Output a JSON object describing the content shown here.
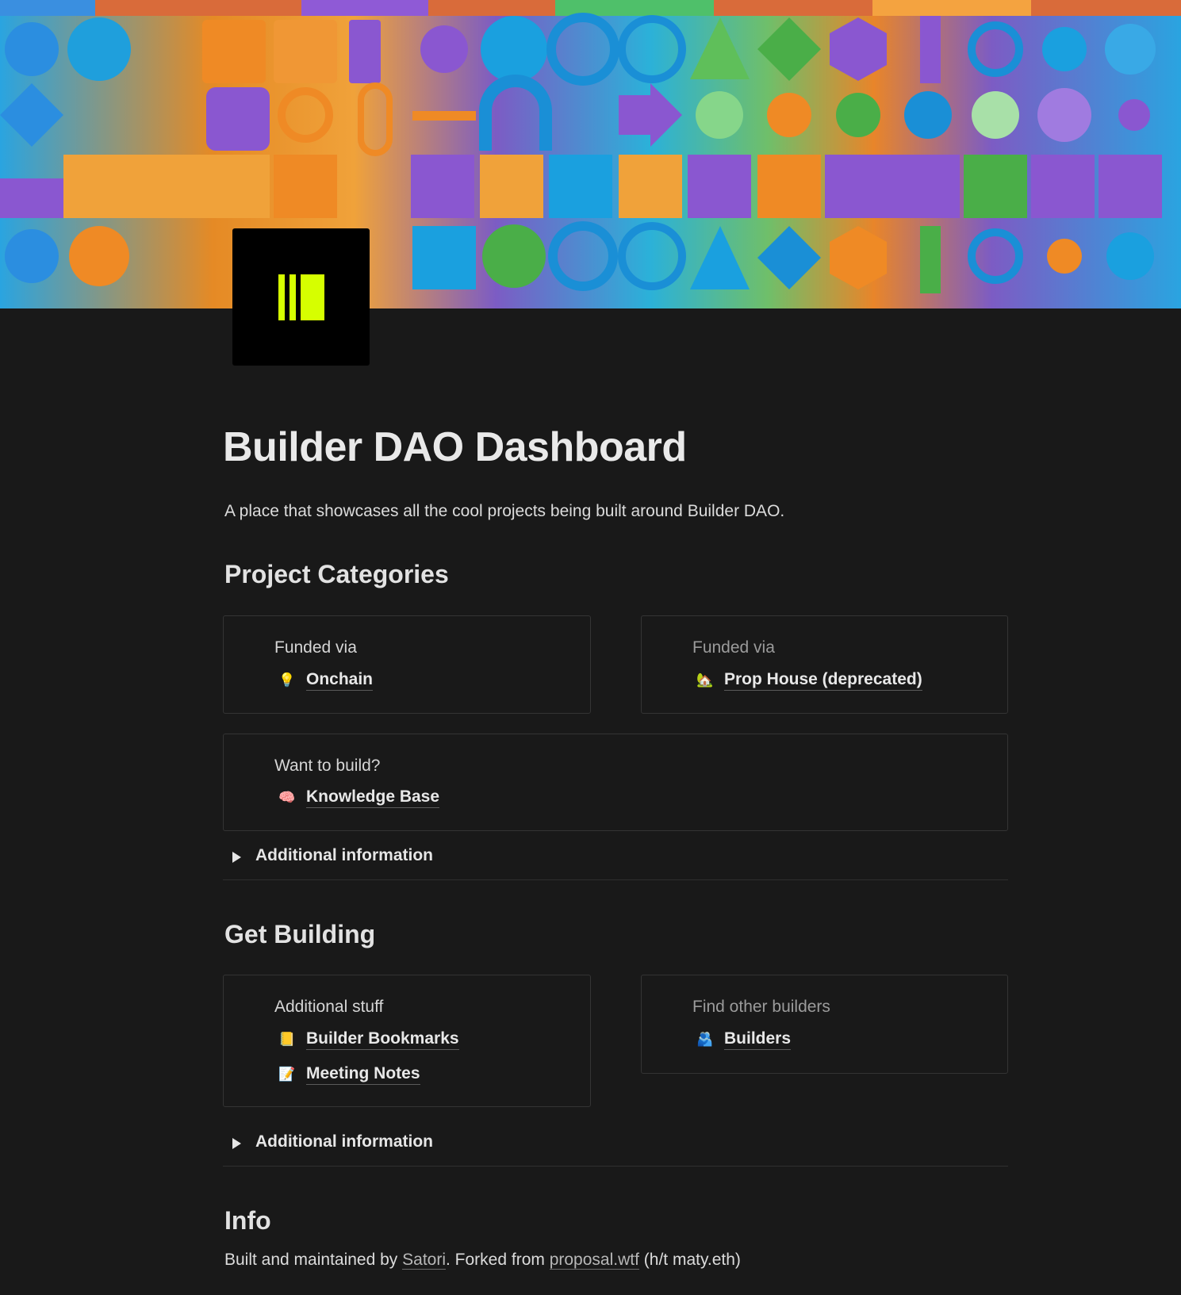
{
  "page": {
    "title": "Builder DAO Dashboard",
    "subtitle": "A place that showcases all the cool projects being built around Builder DAO."
  },
  "colors": {
    "background": "#191919",
    "logo_accent": "#d6ff00",
    "card_border": "#343434"
  },
  "project_categories": {
    "heading": "Project Categories",
    "cards": [
      {
        "label": "Funded via",
        "links": [
          {
            "icon": "lightbulb-icon",
            "glyph": "💡",
            "text": "Onchain"
          }
        ]
      },
      {
        "label": "Funded via",
        "links": [
          {
            "icon": "house-icon",
            "glyph": "🏡",
            "text": "Prop House (deprecated)"
          }
        ]
      },
      {
        "label": "Want to build?",
        "links": [
          {
            "icon": "brain-icon",
            "glyph": "🧠",
            "text": "Knowledge Base"
          }
        ]
      }
    ],
    "toggle_label": "Additional information"
  },
  "get_building": {
    "heading": "Get Building",
    "cards": [
      {
        "label": "Additional stuff",
        "links": [
          {
            "icon": "notebook-icon",
            "glyph": "📒",
            "text": "Builder Bookmarks"
          },
          {
            "icon": "memo-icon",
            "glyph": "📝",
            "text": "Meeting Notes"
          }
        ]
      },
      {
        "label": "Find other builders",
        "links": [
          {
            "icon": "people-icon",
            "glyph": "🫂",
            "text": "Builders"
          }
        ]
      }
    ],
    "toggle_label": "Additional information"
  },
  "info": {
    "heading": "Info",
    "prefix": "Built and maintained by ",
    "author": "Satori",
    "middle": ". Forked from ",
    "fork": "proposal.wtf",
    "suffix": " (h/t maty.eth)"
  }
}
